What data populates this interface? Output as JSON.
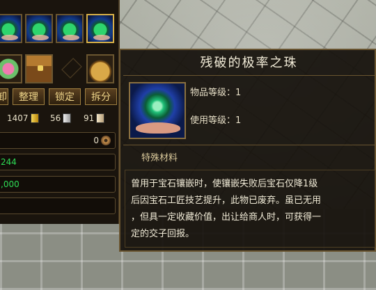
{
  "inventory": {
    "gem_slots": [
      "jade-orb",
      "jade-orb",
      "jade-orb",
      "jade-orb"
    ],
    "item_slots": [
      "flower-item",
      "treasure-chest-item",
      "money-bag-item"
    ],
    "buttons": [
      "卸",
      "整理",
      "锁定",
      "拆分"
    ],
    "currency": [
      {
        "value": "1407",
        "icon": "gold-ingot-icon"
      },
      {
        "value": "56",
        "icon": "silver-ingot-icon"
      },
      {
        "value": "91",
        "icon": "ticket-icon"
      }
    ],
    "copper_value": "0",
    "field2": "244",
    "field3": ",000",
    "field4": ""
  },
  "tooltip": {
    "title": "残破的极率之珠",
    "item_level_label": "物品等级：1",
    "use_level_label": "使用等级：1",
    "category": "特殊材料",
    "description": [
      "曾用于宝石镶嵌时，使镶嵌失败后宝石仅降1级",
      "后因宝石工匠技艺提升，此物已废弃。虽已无用",
      "，但具一定收藏价值，出让给商人时，可获得一",
      "定的交子回报。"
    ]
  },
  "colors": {
    "panel_bg": "#1a140d",
    "border": "#6a5530",
    "button_text": "#f0d68a",
    "green_text": "#2edb55",
    "tooltip_text": "#f2ecd8"
  }
}
